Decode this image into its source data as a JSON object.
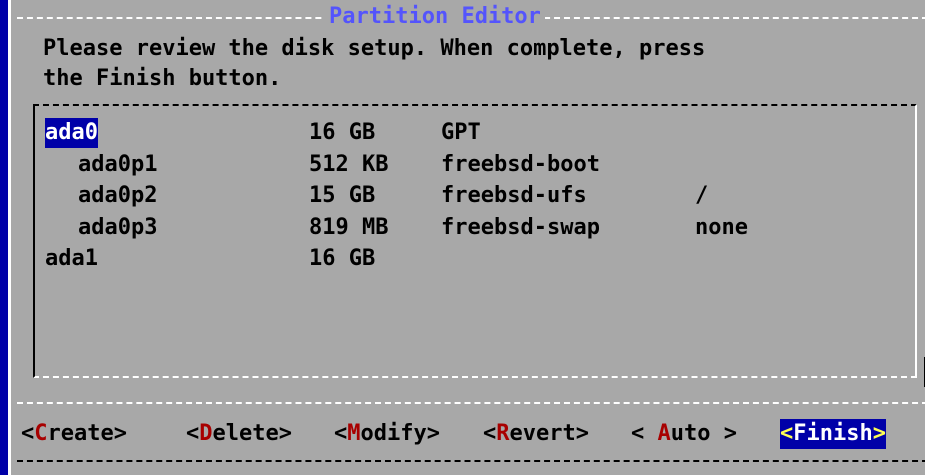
{
  "dialog": {
    "title": "Partition Editor",
    "prompt": "Please review the disk setup. When complete, press\nthe Finish button."
  },
  "partitions": [
    {
      "name": "ada0",
      "size": "16 GB",
      "type": "GPT",
      "mount": "",
      "indent": false,
      "selected": true
    },
    {
      "name": "ada0p1",
      "size": "512 KB",
      "type": "freebsd-boot",
      "mount": "",
      "indent": true,
      "selected": false
    },
    {
      "name": "ada0p2",
      "size": "15 GB",
      "type": "freebsd-ufs",
      "mount": "/",
      "indent": true,
      "selected": false
    },
    {
      "name": "ada0p3",
      "size": "819 MB",
      "type": "freebsd-swap",
      "mount": "none",
      "indent": true,
      "selected": false
    },
    {
      "name": "ada1",
      "size": "16 GB",
      "type": "",
      "mount": "",
      "indent": false,
      "selected": false
    }
  ],
  "buttons": {
    "create": {
      "left": "<",
      "hot": "C",
      "rest": "reate",
      "right": ">"
    },
    "delete": {
      "left": "<",
      "hot": "D",
      "rest": "elete",
      "right": ">"
    },
    "modify": {
      "left": "<",
      "hot": "M",
      "rest": "odify",
      "right": ">"
    },
    "revert": {
      "left": "<",
      "hot": "R",
      "rest": "evert",
      "right": ">"
    },
    "auto": {
      "left": "< ",
      "hot": "A",
      "rest": "uto",
      "right": " >"
    },
    "finish": {
      "left": "<",
      "hot": "F",
      "rest": "inish",
      "right": ">"
    }
  },
  "colors": {
    "background": "#0000a8",
    "dialog": "#a8a8a8",
    "title": "#5454fc",
    "hotkey": "#a80000",
    "selected_bg": "#0000a8",
    "selected_fg": "#ffffff"
  }
}
